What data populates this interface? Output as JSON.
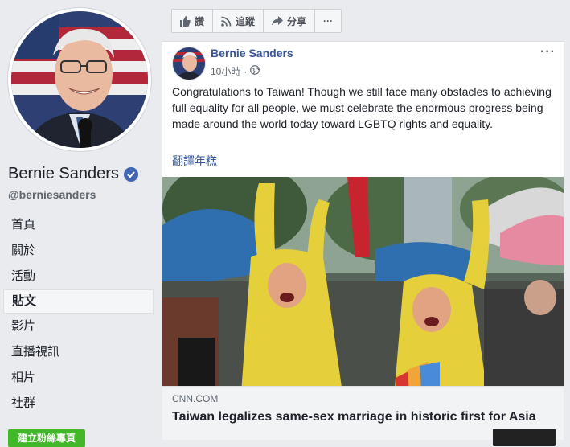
{
  "profile": {
    "name": "Bernie Sanders",
    "handle": "@berniesanders",
    "verified": true
  },
  "nav": {
    "items": [
      {
        "label": "首頁"
      },
      {
        "label": "關於"
      },
      {
        "label": "活動"
      },
      {
        "label": "貼文",
        "active": true
      },
      {
        "label": "影片"
      },
      {
        "label": "直播視訊"
      },
      {
        "label": "相片"
      },
      {
        "label": "社群"
      }
    ],
    "create_button": "建立粉絲專頁"
  },
  "actionbar": {
    "like": "讚",
    "follow": "追蹤",
    "share": "分享",
    "more": "···"
  },
  "post": {
    "author": "Bernie Sanders",
    "time": "10小時",
    "more": "···",
    "text": "Congratulations to Taiwan! Though we still face many obstacles to achieving full equality for all people, we must celebrate the enormous progress being made around the world today toward LGBTQ rights and equality.",
    "translate": "翻譯年糕",
    "info": "i"
  },
  "link": {
    "domain": "CNN.COM",
    "title": "Taiwan legalizes same-sex marriage in historic first for Asia"
  },
  "colors": {
    "brand_blue": "#385898",
    "verified": "#4267b2",
    "create_green": "#42b72a"
  }
}
